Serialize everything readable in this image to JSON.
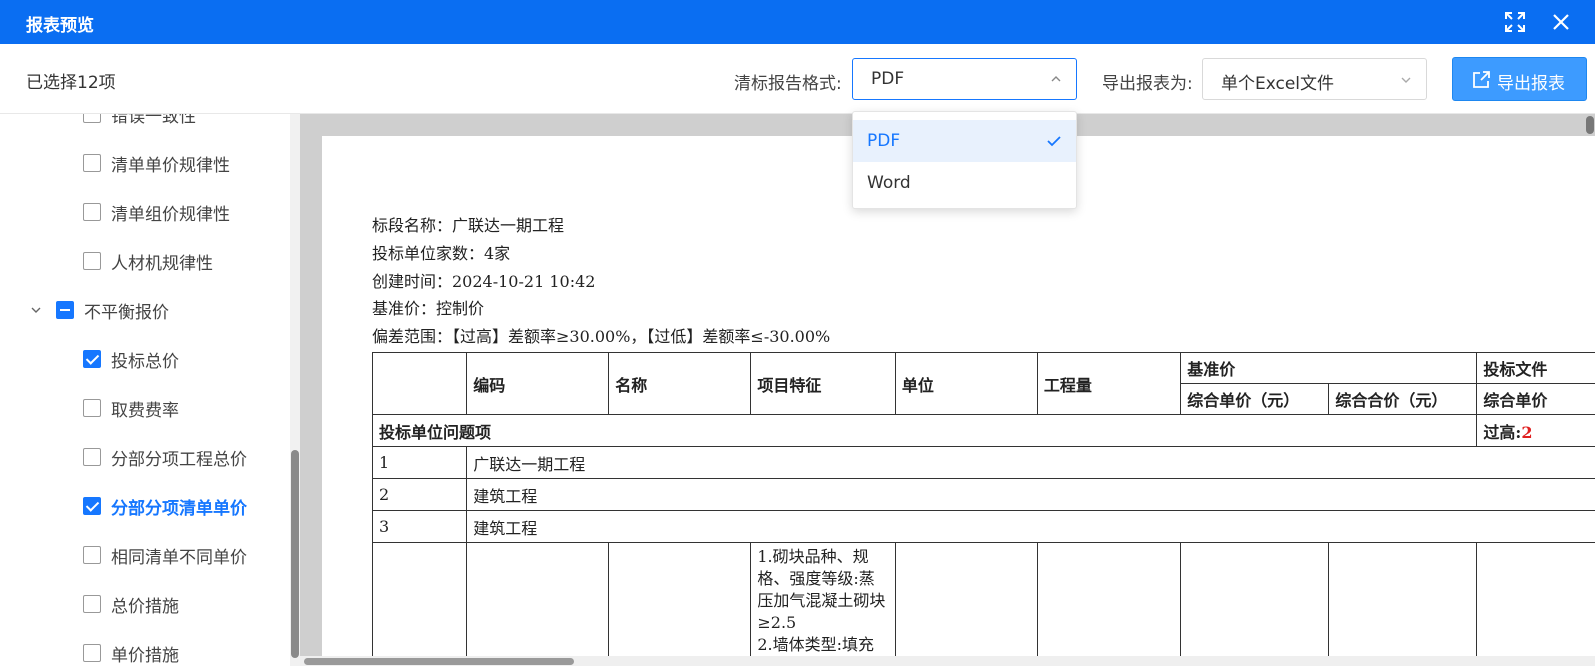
{
  "window": {
    "title": "报表预览"
  },
  "toolbar": {
    "selected_count": "已选择12项",
    "format_label": "清标报告格式:",
    "format_value": "PDF",
    "export_label": "导出报表为:",
    "export_value": "单个Excel文件",
    "export_button": "导出报表"
  },
  "dropdown": {
    "options": [
      "PDF",
      "Word"
    ],
    "selected": "PDF"
  },
  "tree": {
    "items": [
      {
        "label": "错误一致性",
        "checked": false
      },
      {
        "label": "清单单价规律性",
        "checked": false
      },
      {
        "label": "清单组价规律性",
        "checked": false
      },
      {
        "label": "人材机规律性",
        "checked": false
      },
      {
        "label": "不平衡报价",
        "checked": "partial"
      },
      {
        "label": "投标总价",
        "checked": true
      },
      {
        "label": "取费费率",
        "checked": false
      },
      {
        "label": "分部分项工程总价",
        "checked": false
      },
      {
        "label": "分部分项清单单价",
        "checked": true
      },
      {
        "label": "相同清单不同单价",
        "checked": false
      },
      {
        "label": "总价措施",
        "checked": false
      },
      {
        "label": "单价措施",
        "checked": false
      }
    ]
  },
  "report": {
    "meta": [
      "标段名称：广联达一期工程",
      "投标单位家数：4家",
      "创建时间：2024-10-21 10:42",
      "基准价：控制价",
      "偏差范围：【过高】差额率≥30.00%，【过低】差额率≤-30.00%"
    ],
    "headers": {
      "code": "编码",
      "name": "名称",
      "feature": "项目特征",
      "unit": "单位",
      "qty": "工程量",
      "base": "基准价",
      "base_unit_price": "综合单价（元）",
      "base_total_price": "综合合价（元）",
      "bid_doc": "投标文件",
      "bid_unit_price": "综合单价"
    },
    "problem_row": {
      "label": "投标单位问题项",
      "over_label": "过高:",
      "over_value": "2"
    },
    "rows": [
      {
        "no": "1",
        "text": "广联达一期工程"
      },
      {
        "no": "2",
        "text": "建筑工程"
      },
      {
        "no": "3",
        "text": "建筑工程"
      }
    ],
    "feature_text": "1.砌块品种、规格、强度等级:蒸压加气混凝土砌块 ≥2.5\n2.墙体类型:填充"
  }
}
